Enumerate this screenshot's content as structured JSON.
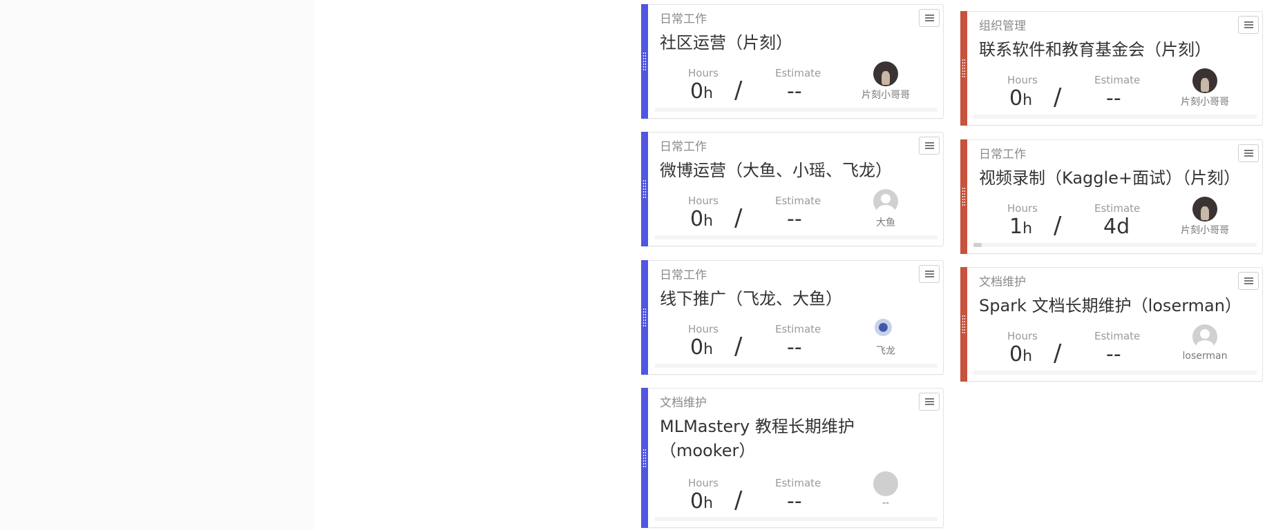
{
  "colors": {
    "blue_accent": "#4f56e0",
    "red_accent": "#c8523d"
  },
  "metric_labels": {
    "hours": "Hours",
    "estimate": "Estimate"
  },
  "columns": [
    {
      "accent": "#4f56e0",
      "cards": [
        {
          "category": "日常工作",
          "title": "社区运营（片刻）",
          "hours_value": "0",
          "hours_unit": "h",
          "estimate": "--",
          "assignee": "片刻小哥哥",
          "avatar": "photo-dark",
          "progress": 0
        },
        {
          "category": "日常工作",
          "title": "微博运营（大鱼、小瑶、飞龙）",
          "hours_value": "0",
          "hours_unit": "h",
          "estimate": "--",
          "assignee": "大鱼",
          "avatar": "default",
          "progress": 0
        },
        {
          "category": "日常工作",
          "title": "线下推广（飞龙、大鱼）",
          "hours_value": "0",
          "hours_unit": "h",
          "estimate": "--",
          "assignee": "飞龙",
          "avatar": "flower",
          "progress": 0
        },
        {
          "category": "文档维护",
          "title": "MLMastery 教程长期维护（mooker）",
          "hours_value": "0",
          "hours_unit": "h",
          "estimate": "--",
          "assignee": "--",
          "avatar": "blank",
          "progress": 0
        }
      ]
    },
    {
      "accent": "#c8523d",
      "cards": [
        {
          "category": "组织管理",
          "title": "联系软件和教育基金会（片刻）",
          "hours_value": "0",
          "hours_unit": "h",
          "estimate": "--",
          "assignee": "片刻小哥哥",
          "avatar": "photo-dark",
          "progress": 0
        },
        {
          "category": "日常工作",
          "title": "视频录制（Kaggle+面试）（片刻）",
          "hours_value": "1",
          "hours_unit": "h",
          "estimate": "4d",
          "assignee": "片刻小哥哥",
          "avatar": "photo-dark",
          "progress": 0.03
        },
        {
          "category": "文档维护",
          "title": "Spark 文档长期维护（loserman）",
          "hours_value": "0",
          "hours_unit": "h",
          "estimate": "--",
          "assignee": "loserman",
          "avatar": "default",
          "progress": 0
        }
      ]
    }
  ]
}
